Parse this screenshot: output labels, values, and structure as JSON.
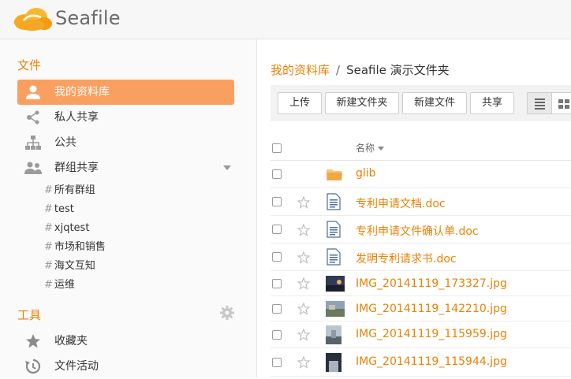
{
  "brand": {
    "name": "Seafile",
    "colors": {
      "accent": "#eb8205",
      "active_bg": "#f9a060"
    }
  },
  "sidebar": {
    "files_title": "文件",
    "nav": [
      {
        "label": "我的资料库",
        "icon": "user-icon",
        "active": true
      },
      {
        "label": "私人共享",
        "icon": "share-icon",
        "active": false
      },
      {
        "label": "公共",
        "icon": "org-icon",
        "active": false
      },
      {
        "label": "群组共享",
        "icon": "group-icon",
        "active": false
      }
    ],
    "groups": [
      "所有群组",
      "test",
      "xjqtest",
      "市场和销售",
      "海文互知",
      "运维"
    ],
    "tools_title": "工具",
    "tools": [
      {
        "label": "收藏夹",
        "icon": "star-icon"
      },
      {
        "label": "文件活动",
        "icon": "history-icon"
      }
    ]
  },
  "breadcrumb": {
    "root": "我的资料库",
    "separator": "/",
    "current": "Seafile 演示文件夹"
  },
  "toolbar": {
    "upload": "上传",
    "new_folder": "新建文件夹",
    "new_file": "新建文件",
    "share": "共享"
  },
  "table": {
    "name_header": "名称",
    "rows": [
      {
        "name": "glib",
        "type": "folder"
      },
      {
        "name": "专利申请文档.doc",
        "type": "doc"
      },
      {
        "name": "专利申请文件确认单.doc",
        "type": "doc"
      },
      {
        "name": "发明专利请求书.doc",
        "type": "doc"
      },
      {
        "name": "IMG_20141119_173327.jpg",
        "type": "image"
      },
      {
        "name": "IMG_20141119_142210.jpg",
        "type": "image"
      },
      {
        "name": "IMG_20141119_115959.jpg",
        "type": "image"
      },
      {
        "name": "IMG_20141119_115944.jpg",
        "type": "image"
      }
    ]
  }
}
